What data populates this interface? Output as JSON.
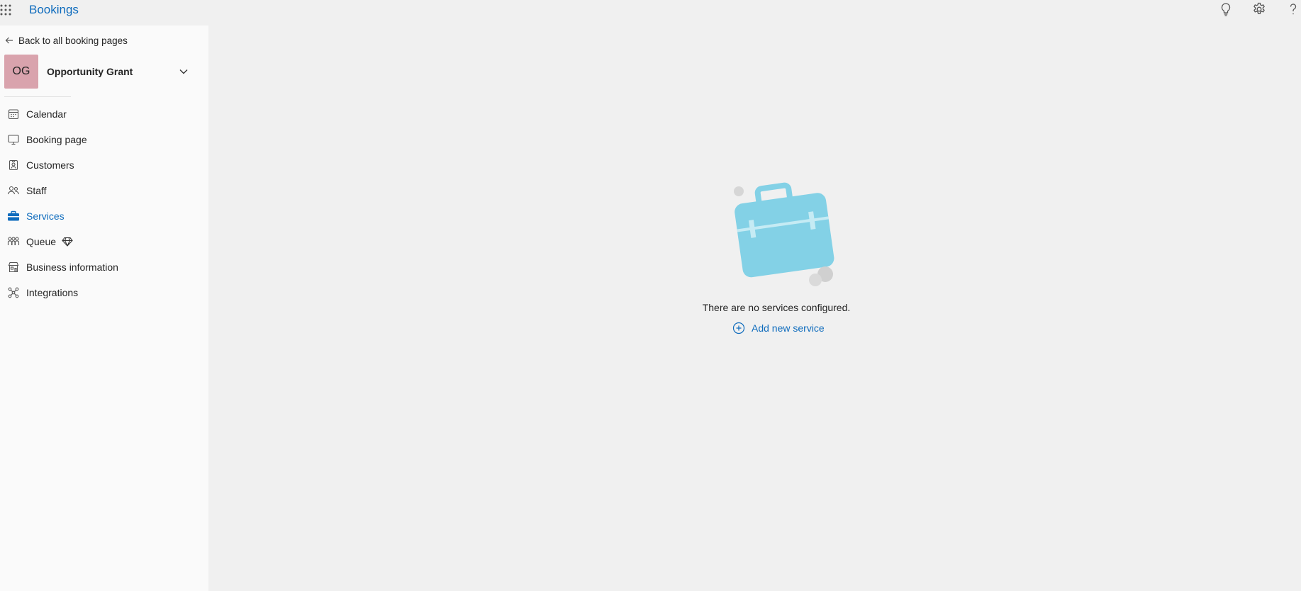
{
  "header": {
    "app_title": "Bookings",
    "icons": [
      "app-launcher-icon",
      "lightbulb-icon",
      "gear-icon",
      "help-icon"
    ]
  },
  "sidebar": {
    "back_label": "Back to all booking pages",
    "account": {
      "initials": "OG",
      "name": "Opportunity Grant",
      "avatar_color": "#d9a3ad"
    },
    "items": [
      {
        "label": "Calendar",
        "icon": "calendar-icon"
      },
      {
        "label": "Booking page",
        "icon": "monitor-icon"
      },
      {
        "label": "Customers",
        "icon": "contact-card-icon"
      },
      {
        "label": "Staff",
        "icon": "people-icon"
      },
      {
        "label": "Services",
        "icon": "briefcase-icon",
        "active": true
      },
      {
        "label": "Queue",
        "icon": "queue-icon",
        "badge": "premium-diamond-icon"
      },
      {
        "label": "Business information",
        "icon": "building-icon"
      },
      {
        "label": "Integrations",
        "icon": "network-icon"
      }
    ]
  },
  "main": {
    "empty_message": "There are no services configured.",
    "add_label": "Add new service"
  },
  "colors": {
    "accent": "#0f6cbd",
    "background": "#f0f0f0",
    "sidebar": "#fafafa",
    "illustration": "#83d1e6"
  }
}
